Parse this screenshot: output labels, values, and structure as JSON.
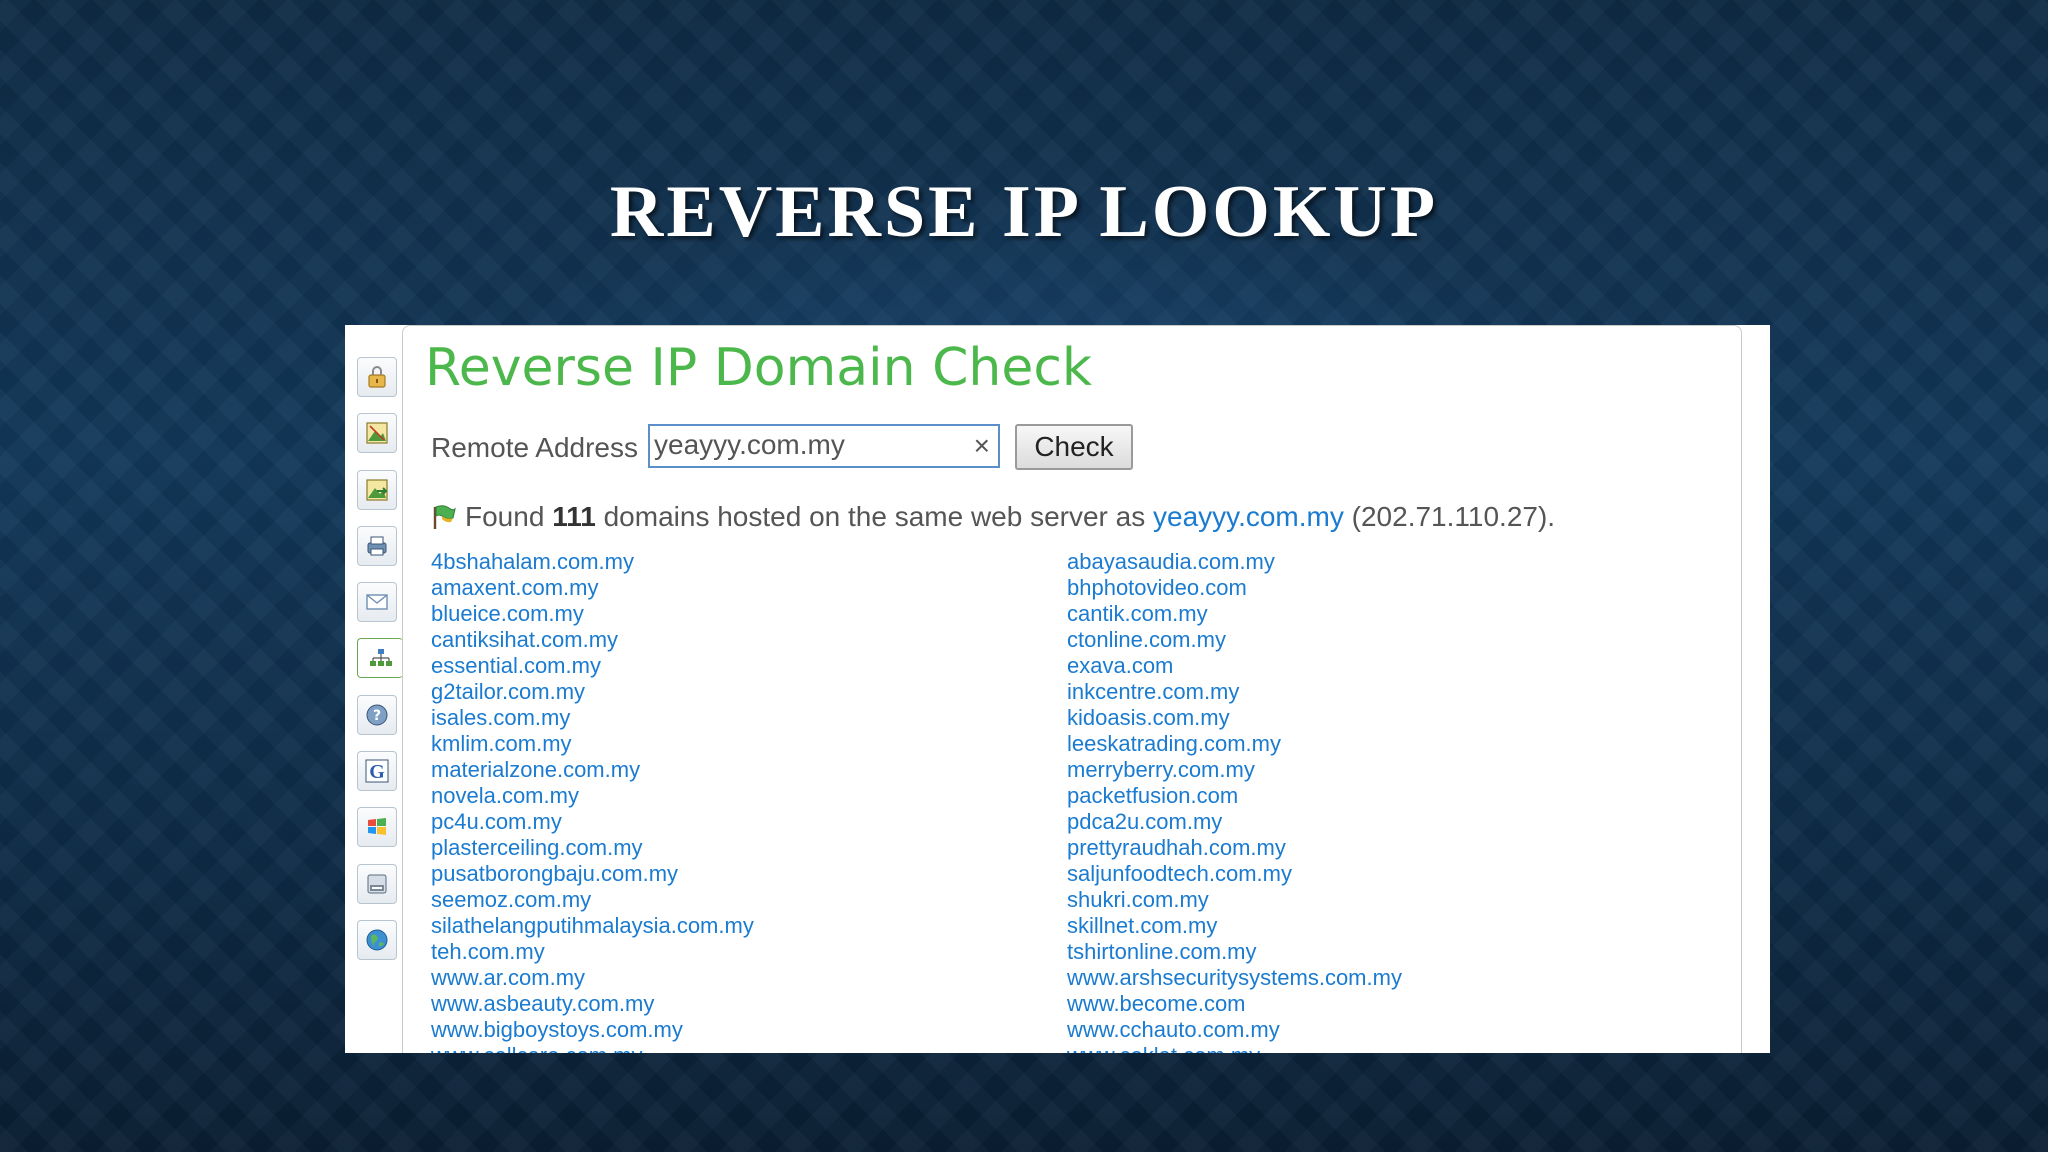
{
  "slide": {
    "title": "Reverse IP Lookup"
  },
  "sidebar": {
    "icons": [
      {
        "name": "lock-icon"
      },
      {
        "name": "image-icon"
      },
      {
        "name": "image-arrow-icon"
      },
      {
        "name": "printer-icon"
      },
      {
        "name": "mail-icon"
      },
      {
        "name": "sitemap-icon"
      },
      {
        "name": "help-icon"
      },
      {
        "name": "google-icon"
      },
      {
        "name": "windows-icon"
      },
      {
        "name": "drive-icon"
      },
      {
        "name": "globe-icon"
      }
    ],
    "active_index": 5
  },
  "panel": {
    "title": "Reverse IP Domain Check",
    "address_label": "Remote Address",
    "address_value": "yeayyy.com.my",
    "clear_label": "×",
    "check_label": "Check",
    "result": {
      "prefix": "Found",
      "count": "111",
      "middle": "domains hosted on the same web server as",
      "domain": "yeayyy.com.my",
      "ip": "(202.71.110.27)."
    }
  },
  "domains_left": [
    "4bshahalam.com.my",
    "amaxent.com.my",
    "blueice.com.my",
    "cantiksihat.com.my",
    "essential.com.my",
    "g2tailor.com.my",
    "isales.com.my",
    "kmlim.com.my",
    "materialzone.com.my",
    "novela.com.my",
    "pc4u.com.my",
    "plasterceiling.com.my",
    "pusatborongbaju.com.my",
    "seemoz.com.my",
    "silathelangputihmalaysia.com.my",
    "teh.com.my",
    "www.ar.com.my",
    "www.asbeauty.com.my",
    "www.bigboystoys.com.my",
    "www.cellcare.com.my"
  ],
  "domains_right": [
    "abayasaudia.com.my",
    "bhphotovideo.com",
    "cantik.com.my",
    "ctonline.com.my",
    "exava.com",
    "inkcentre.com.my",
    "kidoasis.com.my",
    "leeskatrading.com.my",
    "merryberry.com.my",
    "packetfusion.com",
    "pdca2u.com.my",
    "prettyraudhah.com.my",
    "saljunfoodtech.com.my",
    "shukri.com.my",
    "skillnet.com.my",
    "tshirtonline.com.my",
    "www.arshsecuritysystems.com.my",
    "www.become.com",
    "www.cchauto.com.my",
    "www.ceklat.com.my"
  ]
}
